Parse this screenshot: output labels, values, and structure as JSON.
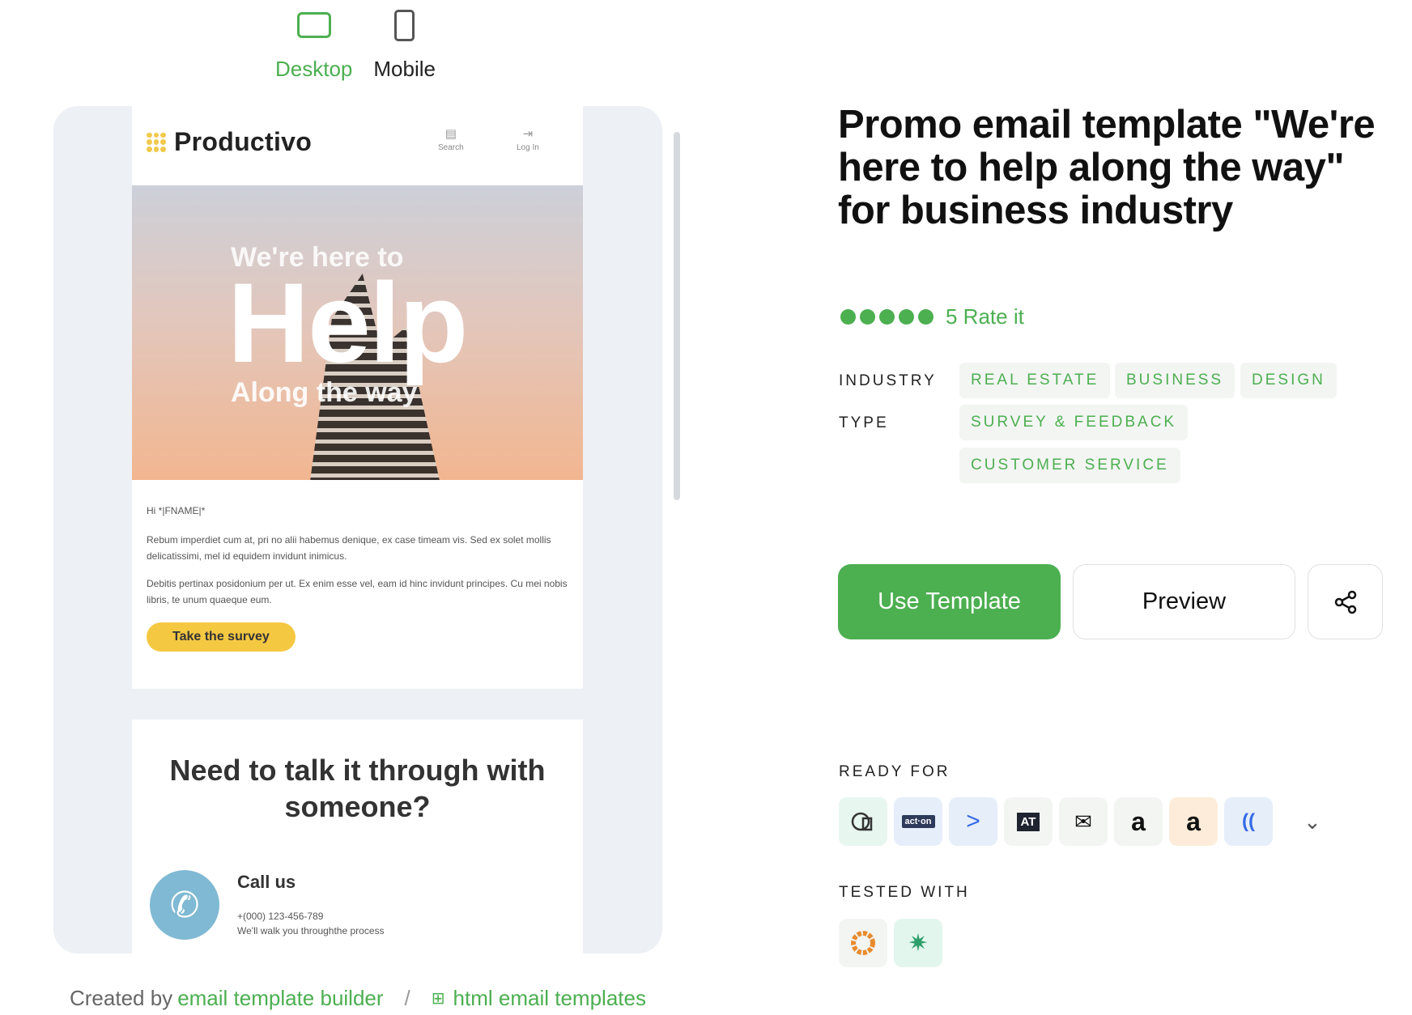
{
  "device_toggle": {
    "desktop_label": "Desktop",
    "mobile_label": "Mobile"
  },
  "email_preview": {
    "brand": "Productivo",
    "header_links": [
      {
        "label": "Search",
        "icon": "search-icon"
      },
      {
        "label": "Log In",
        "icon": "login-icon"
      }
    ],
    "hero": {
      "small_text": "We're here to",
      "big_text": "Help",
      "sub_text": "Along the way"
    },
    "greeting": "Hi *|FNAME|*",
    "paragraph1": "Rebum imperdiet cum at, pri no alii habemus denique, ex case timeam vis. Sed ex solet mollis delicatissimi, mel id equidem invidunt inimicus.",
    "paragraph2": "Debitis pertinax posidonium per ut. Ex enim esse vel, eam id hinc invidunt principes. Cu mei nobis libris, te unum quaeque eum.",
    "cta": "Take the survey",
    "section2_title": "Need to talk it through with someone?",
    "call_title": "Call us",
    "call_phone": "+(000) 123-456-789",
    "call_note": "We'll walk you throughthe process"
  },
  "footer": {
    "created_by": "Created by",
    "builder_link": "email template builder",
    "separator": "/",
    "templates_link": "html email templates"
  },
  "template": {
    "title": "Promo email template \"We're here to help along the way\" for business industry",
    "rating_value": 5,
    "rating_text": "5 Rate it",
    "industry_label": "INDUSTRY",
    "industry_tags": [
      "REAL ESTATE",
      "BUSINESS",
      "DESIGN"
    ],
    "type_label": "TYPE",
    "type_tags": [
      "SURVEY & FEEDBACK",
      "CUSTOMER SERVICE"
    ],
    "use_button": "Use Template",
    "preview_button": "Preview",
    "ready_for_label": "READY FOR",
    "ready_for": [
      {
        "name": "campaign-monitor",
        "glyph": "◯",
        "bg": "#e8f6f0",
        "color": "#333"
      },
      {
        "name": "act-on",
        "glyph": "act-on",
        "bg": "#e6eefa",
        "color": "#333"
      },
      {
        "name": "active-campaign",
        "glyph": ">",
        "bg": "#e6eefa",
        "color": "#356ae6"
      },
      {
        "name": "aweber",
        "glyph": "AT",
        "bg": "#f3f5f3",
        "color": "#fff"
      },
      {
        "name": "email-client",
        "glyph": "✉",
        "bg": "#f3f5f3",
        "color": "#333"
      },
      {
        "name": "amazon-ses",
        "glyph": "a",
        "bg": "#f3f5f3",
        "color": "#111"
      },
      {
        "name": "amazon-pinpoint",
        "glyph": "a",
        "bg": "#fdecd9",
        "color": "#111"
      },
      {
        "name": "braze",
        "glyph": "((",
        "bg": "#e6eefa",
        "color": "#356ae6"
      }
    ],
    "tested_with_label": "TESTED WITH",
    "tested_with": [
      {
        "name": "litmus",
        "glyph": "◉",
        "bg": "#f3f5f3",
        "color": "#e88b2e"
      },
      {
        "name": "email-on-acid",
        "glyph": "✷",
        "bg": "#e3f6ee",
        "color": "#2e9e6a"
      }
    ]
  }
}
